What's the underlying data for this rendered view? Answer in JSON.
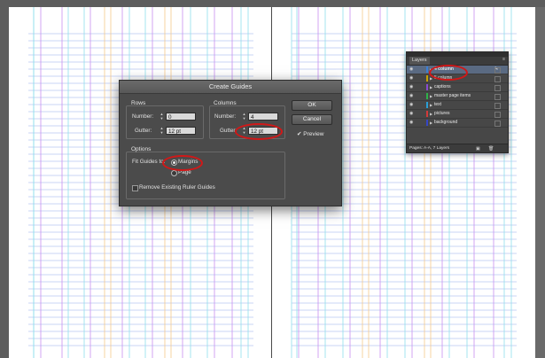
{
  "dialog": {
    "title": "Create Guides",
    "rows": {
      "group_title": "Rows",
      "number_label": "Number:",
      "number_value": "0",
      "gutter_label": "Gutter:",
      "gutter_value": "12 pt"
    },
    "columns": {
      "group_title": "Columns",
      "number_label": "Number:",
      "number_value": "4",
      "gutter_label": "Gutter:",
      "gutter_value": "12 pt"
    },
    "options": {
      "group_title": "Options",
      "fit_label": "Fit Guides to:",
      "margins_label": "Margins",
      "page_label": "Page",
      "selected": "Margins",
      "remove_label": "Remove Existing Ruler Guides",
      "remove_checked": false
    },
    "ok_label": "OK",
    "cancel_label": "Cancel",
    "preview_label": "Preview",
    "preview_checked": true
  },
  "layers_panel": {
    "tab_label": "Layers",
    "menu_icon": "panel-menu-icon",
    "layers": [
      {
        "name": "4 column",
        "color": "#3b7fd6",
        "selected": true
      },
      {
        "name": "5 column",
        "color": "#c8a200",
        "selected": false
      },
      {
        "name": "captions",
        "color": "#8a4bd1",
        "selected": false
      },
      {
        "name": "master page items",
        "color": "#2fb34a",
        "selected": false
      },
      {
        "name": "text",
        "color": "#2a9fd6",
        "selected": false
      },
      {
        "name": "pictures",
        "color": "#d33a3a",
        "selected": false
      },
      {
        "name": "background",
        "color": "#3546c6",
        "selected": false
      }
    ],
    "footer_text": "Pages: A-A, 7 Layers"
  },
  "colors": {
    "guide_cyan": "#8fe0ec",
    "guide_magenta": "#c88ef0",
    "guide_yellow": "#f5c98a",
    "guide_row": "#b9c7f2",
    "highlight_ring": "#d01818"
  }
}
